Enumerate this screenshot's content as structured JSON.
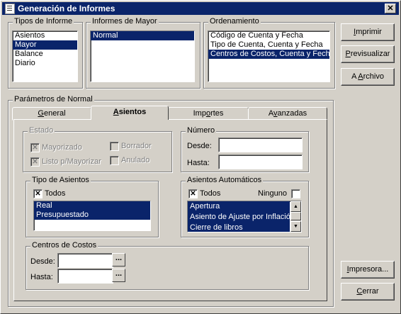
{
  "window": {
    "title": "Generación de Informes",
    "close": "✕"
  },
  "tipos": {
    "title": "Tipos de Informe",
    "items": [
      "Asientos",
      "Mayor",
      "Balance",
      "Diario"
    ]
  },
  "mayor": {
    "title": "Informes de Mayor",
    "items": [
      "Normal"
    ]
  },
  "orden": {
    "title": "Ordenamiento",
    "items": [
      "Código de Cuenta y Fecha",
      "Tipo de Cuenta, Cuenta  y Fecha",
      "Centros de Costos, Cuenta y Fecha"
    ]
  },
  "buttons": {
    "imprimir": {
      "pre": "",
      "u": "I",
      "post": "mprimir"
    },
    "previsualizar": {
      "pre": "",
      "u": "P",
      "post": "revisualizar"
    },
    "archivo": {
      "pre": "A ",
      "u": "A",
      "post": "rchivo"
    },
    "impresora": {
      "pre": "",
      "u": "I",
      "post": "mpresora..."
    },
    "cerrar": {
      "pre": "",
      "u": "C",
      "post": "errar"
    }
  },
  "params": {
    "title": "Parámetros de Normal",
    "tabs": {
      "general": {
        "pre": "",
        "u": "G",
        "post": "eneral"
      },
      "asientos": {
        "pre": "",
        "u": "A",
        "post": "sientos"
      },
      "importes": {
        "pre": "Imp",
        "u": "o",
        "post": "rtes"
      },
      "avanzadas": {
        "pre": "A",
        "u": "v",
        "post": "anzadas"
      }
    }
  },
  "estado": {
    "title": "Estado",
    "mayorizado": "Mayorizado",
    "listo": "Listo p/Mayorizar",
    "borrador": "Borrador",
    "anulado": "Anulado"
  },
  "numero": {
    "title": "Número",
    "desde": "Desde:",
    "hasta": "Hasta:"
  },
  "tipoAsientos": {
    "title": "Tipo de Asientos",
    "todos": "Todos",
    "items": [
      "Real",
      "Presupuestado"
    ]
  },
  "automaticos": {
    "title": "Asientos Automáticos",
    "todos": "Todos",
    "ninguno": "Ninguno",
    "items": [
      "Apertura",
      "Asiento de Ajuste por Inflación",
      "Cierre de libros"
    ]
  },
  "centros": {
    "title": "Centros de Costos",
    "desde": "Desde:",
    "hasta": "Hasta:",
    "ellipsis": "..."
  },
  "checkmark": "✕"
}
